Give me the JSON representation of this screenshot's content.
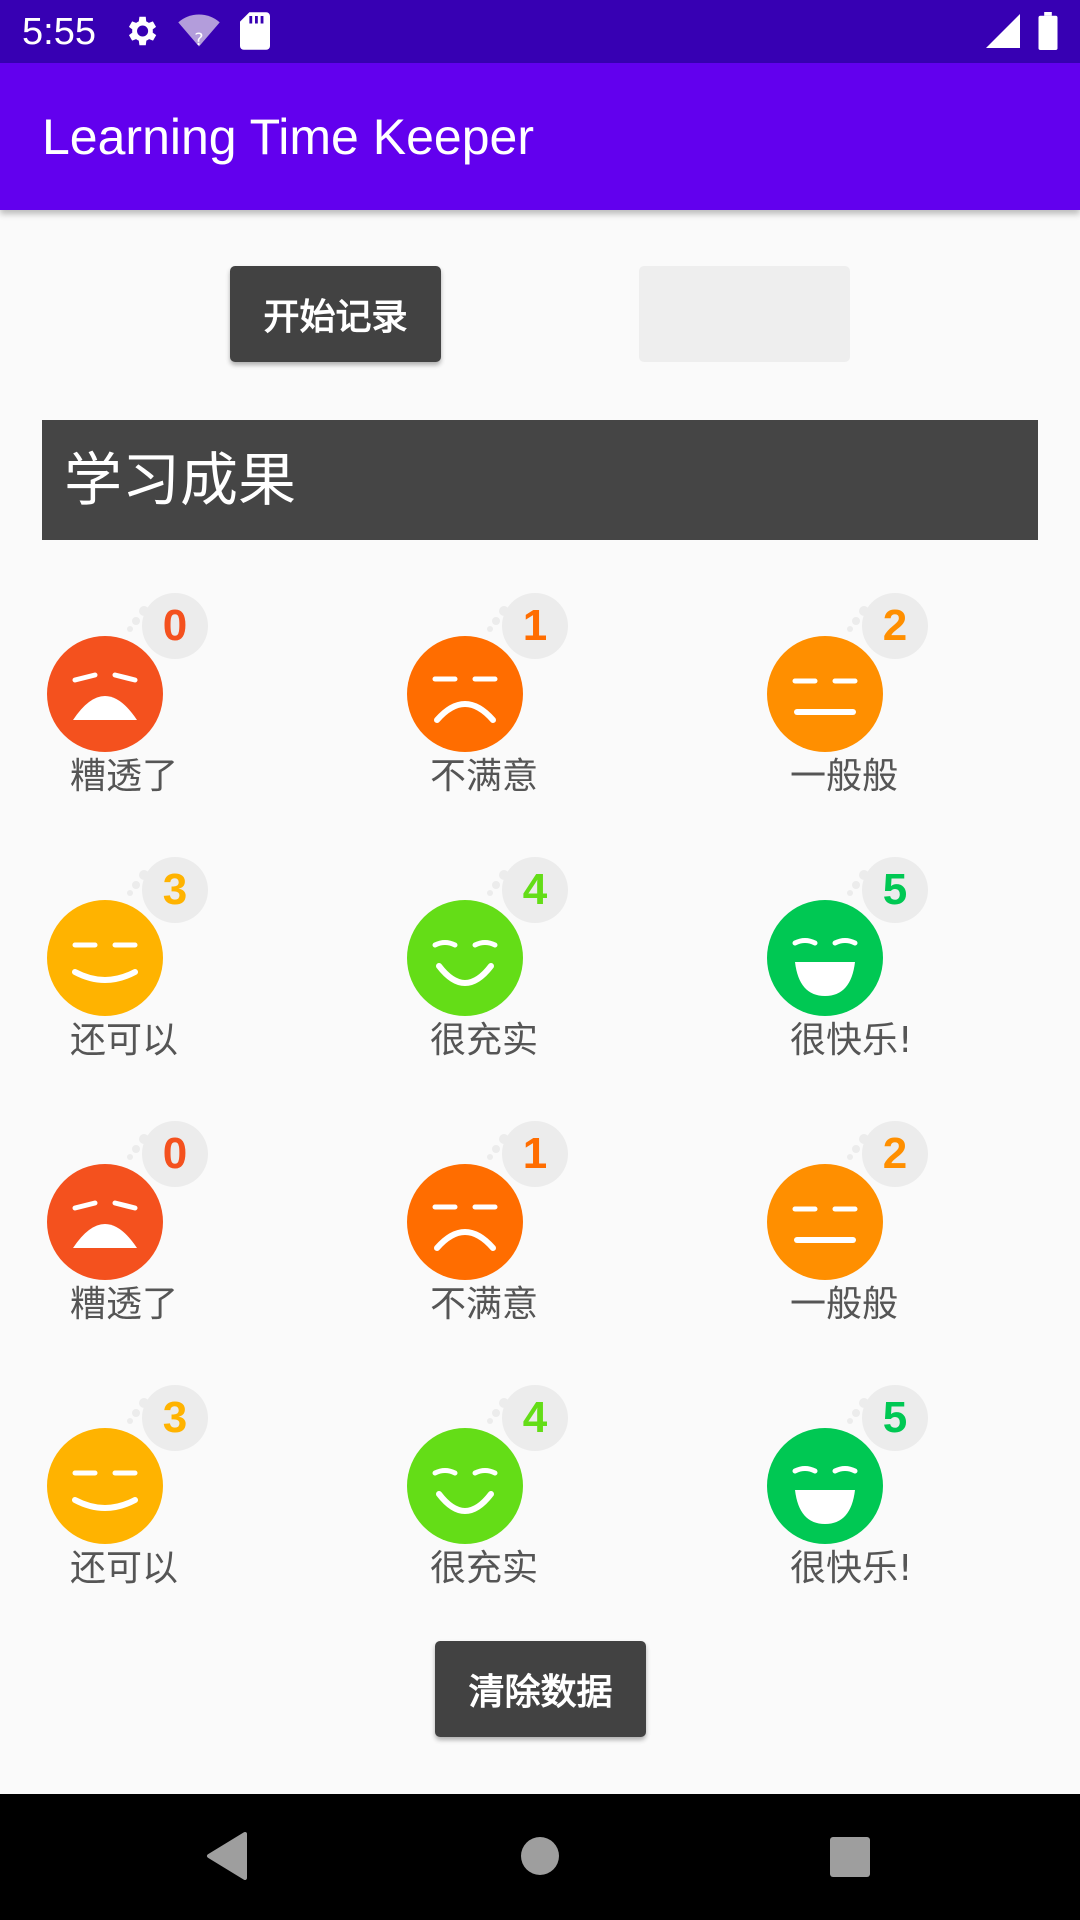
{
  "status_bar": {
    "time": "5:55",
    "icons": [
      "gear-icon",
      "wifi-question-icon",
      "sd-card-icon",
      "signal-icon",
      "battery-icon"
    ]
  },
  "app_bar": {
    "title": "Learning Time Keeper"
  },
  "controls": {
    "start_label": "开始记录",
    "disabled_label": "",
    "clear_label": "清除数据"
  },
  "results": {
    "title": "学习成果"
  },
  "ratings": [
    {
      "score": "0",
      "label": "糟透了",
      "color": "#f4511e",
      "face": "awful"
    },
    {
      "score": "1",
      "label": "不满意",
      "color": "#ff6d00",
      "face": "bad"
    },
    {
      "score": "2",
      "label": "一般般",
      "color": "#ff8f00",
      "face": "neutral"
    },
    {
      "score": "3",
      "label": "还可以",
      "color": "#ffb300",
      "face": "ok"
    },
    {
      "score": "4",
      "label": "很充实",
      "color": "#64dd17",
      "face": "good"
    },
    {
      "score": "5",
      "label": "很快乐!",
      "color": "#00c853",
      "face": "great"
    },
    {
      "score": "0",
      "label": "糟透了",
      "color": "#f4511e",
      "face": "awful"
    },
    {
      "score": "1",
      "label": "不满意",
      "color": "#ff6d00",
      "face": "bad"
    },
    {
      "score": "2",
      "label": "一般般",
      "color": "#ff8f00",
      "face": "neutral"
    },
    {
      "score": "3",
      "label": "还可以",
      "color": "#ffb300",
      "face": "ok"
    },
    {
      "score": "4",
      "label": "很充实",
      "color": "#64dd17",
      "face": "good"
    },
    {
      "score": "5",
      "label": "很快乐!",
      "color": "#00c853",
      "face": "great"
    }
  ],
  "nav_bar": {
    "icons": [
      "back-icon",
      "home-icon",
      "recents-icon"
    ]
  },
  "colors": {
    "status_bar": "#3700b3",
    "app_bar": "#6200ee",
    "button": "#424242",
    "results_header": "#454545"
  }
}
